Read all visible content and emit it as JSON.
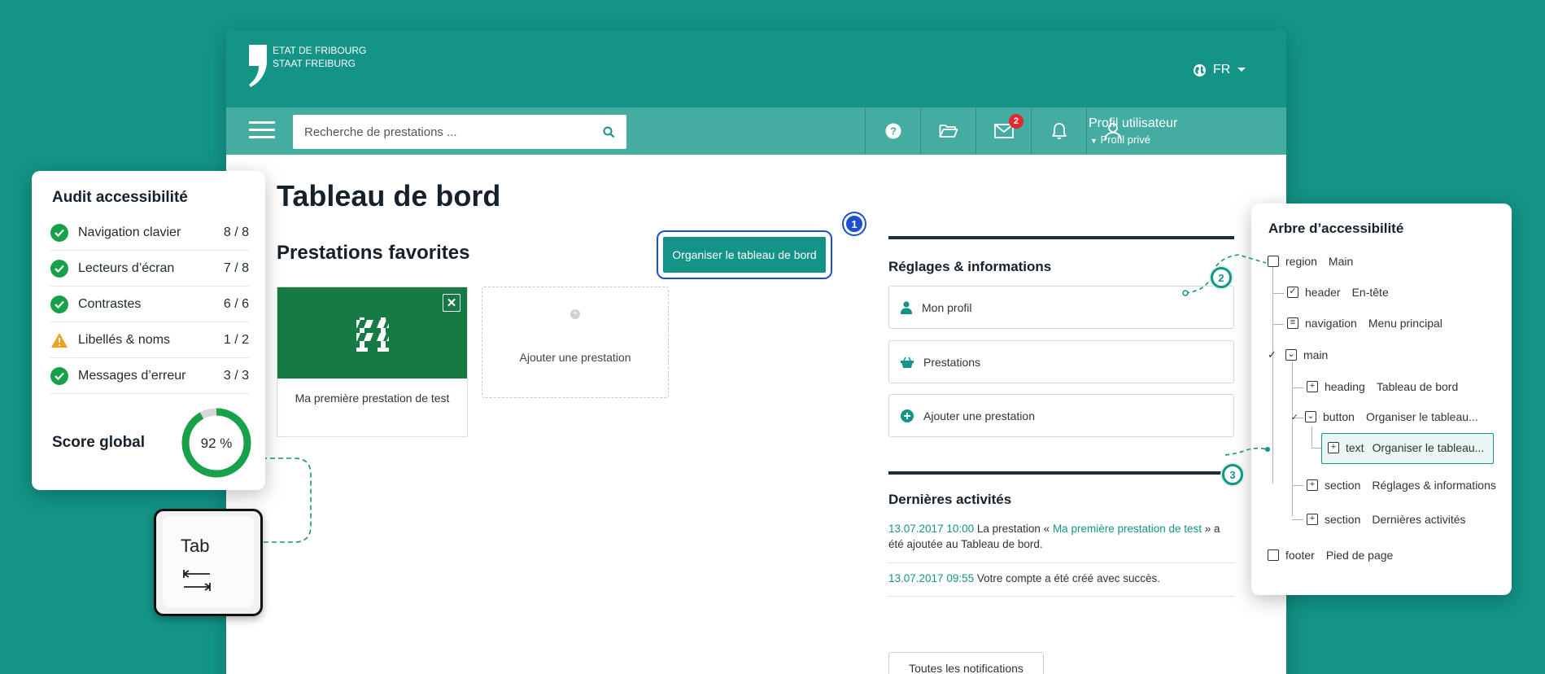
{
  "header": {
    "logo_line1": "ETAT DE FRIBOURG",
    "logo_line2": "STAAT FREIBURG",
    "language": "FR"
  },
  "toolbar": {
    "search_placeholder": "Recherche de prestations ...",
    "messages_badge": "2",
    "profile_name": "Profil utilisateur",
    "profile_type": "Profil privé",
    "icons": [
      "menu-icon",
      "search-icon",
      "help-icon",
      "folder-icon",
      "mail-icon",
      "bell-icon",
      "user-icon"
    ]
  },
  "main": {
    "title": "Tableau de bord",
    "favorites_heading": "Prestations favorites",
    "organize_button": "Organiser le tableau de bord",
    "card_title": "Ma première prestation de test",
    "add_card_label": "Ajouter une prestation"
  },
  "settings": {
    "heading": "Réglages & informations",
    "items": [
      {
        "label": "Mon profil",
        "icon": "person-icon"
      },
      {
        "label": "Prestations",
        "icon": "basket-icon"
      },
      {
        "label": "Ajouter une prestation",
        "icon": "plus-circle-icon"
      }
    ]
  },
  "activities": {
    "heading": "Dernières activités",
    "items": [
      {
        "date": "13.07.2017 10:00",
        "pre": " La prestation « ",
        "link": "Ma première prestation de test",
        "post": " » a été ajoutée au Tableau de bord."
      },
      {
        "date": "13.07.2017 09:55",
        "pre": " Votre compte a été créé avec succès.",
        "link": "",
        "post": ""
      }
    ],
    "all_button": "Toutes les notifications"
  },
  "audit": {
    "title": "Audit accessibilité",
    "rows": [
      {
        "label": "Navigation clavier",
        "score": "8 / 8",
        "status": "ok"
      },
      {
        "label": "Lecteurs d’écran",
        "score": "7 / 8",
        "status": "ok"
      },
      {
        "label": "Contrastes",
        "score": "6 / 6",
        "status": "ok"
      },
      {
        "label": "Libellés & noms",
        "score": "1 / 2",
        "status": "warning"
      },
      {
        "label": "Messages d’erreur",
        "score": "3 / 3",
        "status": "ok"
      }
    ],
    "global_label": "Score global",
    "global_score": "92 %",
    "global_value": 92
  },
  "key": {
    "label": "Tab"
  },
  "tree": {
    "title": "Arbre d’accessibilité",
    "nodes": [
      {
        "role": "region",
        "name": "Main"
      },
      {
        "role": "header",
        "name": "En-tête"
      },
      {
        "role": "navigation",
        "name": "Menu principal"
      },
      {
        "role": "main",
        "name": ""
      },
      {
        "role": "heading",
        "name": "Tableau de bord"
      },
      {
        "role": "button",
        "name": "Organiser le tableau..."
      },
      {
        "role": "text",
        "name": "Organiser le tableau..."
      },
      {
        "role": "section",
        "name": "Réglages & informations"
      },
      {
        "role": "section",
        "name": "Dernières activités"
      },
      {
        "role": "footer",
        "name": "Pied de page"
      }
    ]
  },
  "steps": [
    "1",
    "2",
    "3"
  ],
  "colors": {
    "brand": "#139487",
    "toolbar": "#45aca1",
    "card": "#167a44",
    "focus": "#1a4fd6",
    "ok": "#17a24a",
    "warning": "#f0a020",
    "badge": "#e0292f"
  }
}
